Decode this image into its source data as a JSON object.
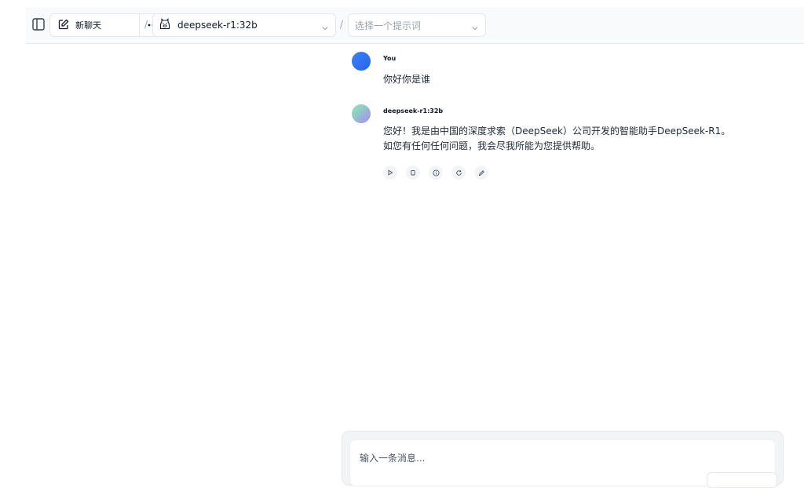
{
  "header": {
    "new_chat_label": "新聊天",
    "model_name": "deepseek-r1:32b",
    "prompt_placeholder": "选择一个提示词",
    "separator": "/"
  },
  "messages": [
    {
      "role": "user",
      "name": "You",
      "text": "你好你是谁"
    },
    {
      "role": "assistant",
      "name": "deepseek-r1:32b",
      "lines": [
        "您好！我是由中国的深度求索（DeepSeek）公司开发的智能助手DeepSeek-R1。",
        "如您有任何任何问题，我会尽我所能为您提供帮助。"
      ]
    }
  ],
  "message_actions": [
    "play-icon",
    "copy-icon",
    "info-icon",
    "regenerate-icon",
    "edit-icon"
  ],
  "composer": {
    "placeholder": "输入一条消息..."
  },
  "colors": {
    "user_avatar": "#3b82f6",
    "bot_avatar_from": "#86efac",
    "bot_avatar_to": "#a78bfa"
  }
}
